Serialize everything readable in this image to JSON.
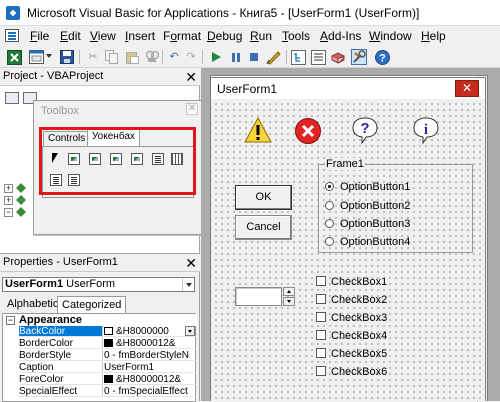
{
  "window": {
    "title": "Microsoft Visual Basic for Applications - Книга5 - [UserForm1 (UserForm)]"
  },
  "menu": [
    {
      "label": "File",
      "key": "F"
    },
    {
      "label": "Edit",
      "key": "E"
    },
    {
      "label": "View",
      "key": "V"
    },
    {
      "label": "Insert",
      "key": "I"
    },
    {
      "label": "Format",
      "key": "o"
    },
    {
      "label": "Debug",
      "key": "D"
    },
    {
      "label": "Run",
      "key": "R"
    },
    {
      "label": "Tools",
      "key": "T"
    },
    {
      "label": "Add-Ins",
      "key": "A"
    },
    {
      "label": "Window",
      "key": "W"
    },
    {
      "label": "Help",
      "key": "H"
    }
  ],
  "project": {
    "title": "Project - VBAProject",
    "close": "✕"
  },
  "toolbox": {
    "title": "Toolbox",
    "tabs": [
      {
        "label": "Controls"
      },
      {
        "label": "Уокенбах"
      }
    ]
  },
  "properties": {
    "title": "Properties - UserForm1",
    "object": {
      "name": "UserForm1",
      "type": "UserForm"
    },
    "tabs": [
      {
        "label": "Alphabetic"
      },
      {
        "label": "Categorized"
      }
    ],
    "category": "Appearance",
    "rows": [
      {
        "name": "BackColor",
        "value": "&H8000000",
        "swatch": "#ffffff"
      },
      {
        "name": "BorderColor",
        "value": "&H8000012&",
        "swatch": "#000000"
      },
      {
        "name": "BorderStyle",
        "value": "0 - fmBorderStyleN",
        "swatch": ""
      },
      {
        "name": "Caption",
        "value": "UserForm1",
        "swatch": ""
      },
      {
        "name": "ForeColor",
        "value": "&H80000012&",
        "swatch": "#000000"
      },
      {
        "name": "SpecialEffect",
        "value": "0 - fmSpecialEffect",
        "swatch": ""
      }
    ]
  },
  "userform": {
    "title": "UserForm1",
    "close": "✕",
    "frame_caption": "Frame1",
    "buttons": [
      {
        "label": "OK"
      },
      {
        "label": "Cancel"
      }
    ],
    "options": [
      {
        "label": "OptionButton1",
        "checked": true
      },
      {
        "label": "OptionButton2",
        "checked": false
      },
      {
        "label": "OptionButton3",
        "checked": false
      },
      {
        "label": "OptionButton4",
        "checked": false
      }
    ],
    "checkboxes": [
      {
        "label": "CheckBox1"
      },
      {
        "label": "CheckBox2"
      },
      {
        "label": "CheckBox3"
      },
      {
        "label": "CheckBox4"
      },
      {
        "label": "CheckBox5"
      },
      {
        "label": "CheckBox6"
      }
    ],
    "icons": [
      "warning-icon",
      "critical-icon",
      "question-icon",
      "information-icon"
    ]
  },
  "colors": {
    "highlight": "#e4141b",
    "selection": "#0078d7",
    "close_red": "#c42b1c"
  }
}
